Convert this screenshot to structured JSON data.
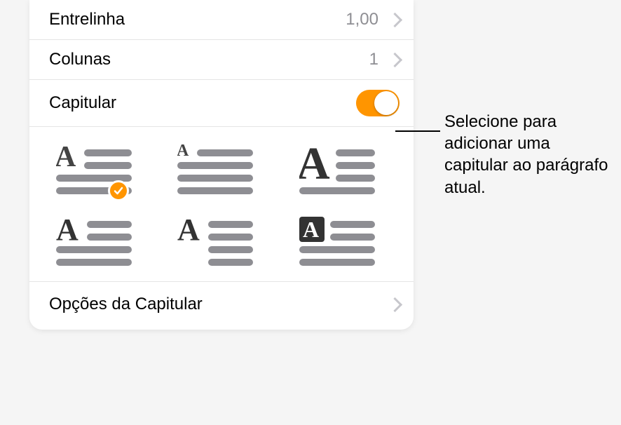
{
  "rows": {
    "lineSpacing": {
      "label": "Entrelinha",
      "value": "1,00"
    },
    "columns": {
      "label": "Colunas",
      "value": "1"
    },
    "dropCap": {
      "label": "Capitular"
    },
    "options": {
      "label": "Opções da Capitular"
    }
  },
  "styles": [
    {
      "id": "style-1",
      "selected": true
    },
    {
      "id": "style-2",
      "selected": false
    },
    {
      "id": "style-3",
      "selected": false
    },
    {
      "id": "style-4",
      "selected": false
    },
    {
      "id": "style-5",
      "selected": false
    },
    {
      "id": "style-6",
      "selected": false
    }
  ],
  "callout": "Selecione para adicionar uma capitular ao parágrafo atual.",
  "colors": {
    "accent": "#ff9500",
    "line": "#8e8e93"
  }
}
